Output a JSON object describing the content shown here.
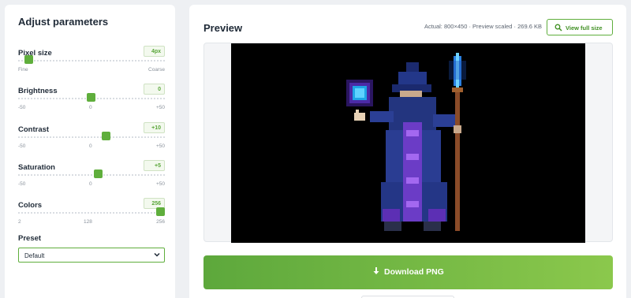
{
  "left_panel": {
    "title": "Adjust parameters",
    "params": [
      {
        "label": "Pixel size",
        "value": "4px",
        "min_label": "Fine",
        "max_label": "Coarse",
        "level": 0.06
      },
      {
        "label": "Brightness",
        "value": "0",
        "min_label": "-50",
        "mid_label": "0",
        "max_label": "+50",
        "level": 0.5
      },
      {
        "label": "Contrast",
        "value": "+10",
        "min_label": "-50",
        "mid_label": "0",
        "max_label": "+50",
        "level": 0.6
      },
      {
        "label": "Saturation",
        "value": "+5",
        "min_label": "-50",
        "mid_label": "0",
        "max_label": "+50",
        "level": 0.55
      },
      {
        "label": "Colors",
        "value": "256",
        "min_label": "2",
        "mid_label": "128",
        "max_label": "256",
        "level": 1.0
      }
    ],
    "preset": {
      "label": "Preset",
      "selected": "Default"
    }
  },
  "right_panel": {
    "title": "Preview",
    "info": "Actual: 800×450 · Preview scaled · 269.6 KB",
    "view_full_label": "View full size",
    "download_label": "Download PNG"
  },
  "colors": {
    "accent": "#5fae3c",
    "preview_bg": "#000000"
  },
  "icons": {
    "view_full": "magnifier-icon",
    "download": "download-arrow-icon",
    "select": "chevron-down-icon"
  }
}
